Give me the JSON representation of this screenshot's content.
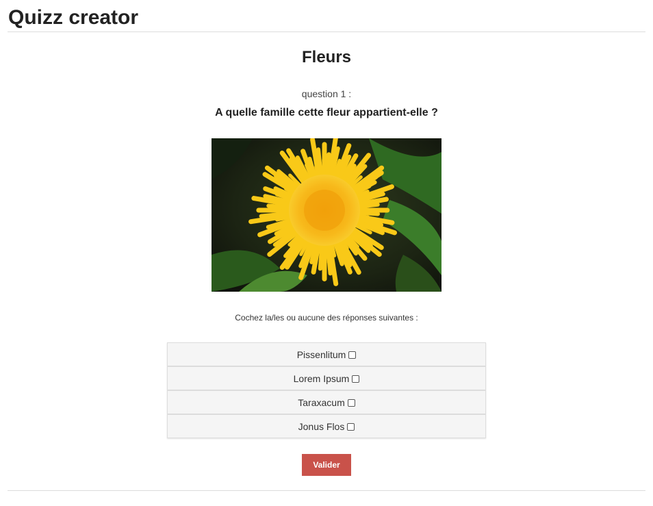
{
  "app": {
    "title": "Quizz creator"
  },
  "quiz": {
    "title": "Fleurs",
    "question_number": "question 1 :",
    "question_text": "A quelle famille cette fleur appartient-elle ?",
    "instructions": "Cochez la/les ou aucune des réponses suivantes :",
    "answers": [
      {
        "label": "Pissenlitum",
        "checked": false
      },
      {
        "label": "Lorem Ipsum",
        "checked": false
      },
      {
        "label": "Taraxacum",
        "checked": false
      },
      {
        "label": "Jonus Flos",
        "checked": false
      }
    ],
    "validate_label": "Valider"
  },
  "colors": {
    "accent": "#c9524a",
    "flower": "#f5c518",
    "answer_bg": "#f5f5f5"
  }
}
